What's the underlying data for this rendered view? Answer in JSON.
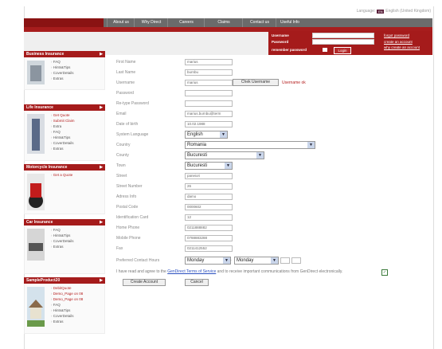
{
  "header": {
    "language_label": "Language:",
    "language_flag": "EN",
    "language_value": "English (United Kingdom)",
    "nav": [
      "About us",
      "Why Direct",
      "Careers",
      "Claims",
      "Contact us",
      "Useful Info"
    ]
  },
  "login": {
    "username_label": "Username",
    "password_label": "Password",
    "remember_label": "remember password",
    "login_button": "Login",
    "forgot_password": "forgot password",
    "create_account": "create an account",
    "why_create": "why create an account"
  },
  "sidebar": [
    {
      "title": "Business Insurance",
      "items": [
        "FAQ",
        "Hints&Tips",
        "CoverDetails",
        "Extras"
      ],
      "highlight": []
    },
    {
      "title": "Life Insurance",
      "items": [
        "Get Quote",
        "Submit Claim",
        "Extra",
        "FAQ",
        "Hints&Tips",
        "CoverDetails",
        "Extras"
      ],
      "highlight": [
        0,
        1
      ]
    },
    {
      "title": "Motorcycle Insurance",
      "items": [
        "Get a Quote"
      ],
      "highlight": [
        0
      ]
    },
    {
      "title": "Car Insurance",
      "items": [
        "FAQ",
        "Hints&Tips",
        "CoverDetails",
        "Extras"
      ],
      "highlight": []
    },
    {
      "title": "SampleProduct20",
      "items": [
        "DebitQuote",
        "Demo_Page on 08",
        "Demo_Page on 08",
        "FAQ",
        "Hints&Tips",
        "CoverDetails",
        "Extras"
      ],
      "highlight": [
        0,
        1,
        2
      ]
    }
  ],
  "form": {
    "first_name": {
      "label": "First Name",
      "value": "marius"
    },
    "last_name": {
      "label": "Last Name",
      "value": "burnbu"
    },
    "username": {
      "label": "Username",
      "value": "marius",
      "check_button": "Chek Username",
      "availability": "Username ok"
    },
    "password": {
      "label": "Password",
      "value": ""
    },
    "retype_password": {
      "label": "Re-type Password",
      "value": ""
    },
    "email": {
      "label": "Email",
      "value": "marius.burnbu@term"
    },
    "dob": {
      "label": "Date of birth",
      "value": "10.02.1988"
    },
    "system_language": {
      "label": "System Language",
      "value": "English"
    },
    "country": {
      "label": "Country",
      "value": "Romania"
    },
    "county": {
      "label": "County",
      "value": "Bucuresti"
    },
    "town": {
      "label": "Town",
      "value": "Bucuresti"
    },
    "street": {
      "label": "Street",
      "value": "paneiori"
    },
    "street_number": {
      "label": "Street Number",
      "value": "26"
    },
    "address_info": {
      "label": "Adress Info",
      "value": "damo"
    },
    "postal_code": {
      "label": "Postal Code",
      "value": "0000602"
    },
    "identification_card": {
      "label": "Identification Card",
      "value": "12"
    },
    "home_phone": {
      "label": "Home Phone",
      "value": "0211888882"
    },
    "mobile_phone": {
      "label": "Mobile Phone",
      "value": "0788883288"
    },
    "fax": {
      "label": "Fax",
      "value": "0211412552"
    },
    "contact_hours": {
      "label": "Preferred Contact Hours",
      "from_day": "Monday",
      "to_day": "Monday",
      "separator": "-"
    },
    "terms_pre": "I have read and agree to the",
    "terms_link": "GenDirect Terms of Service",
    "terms_post": "and to receive important communications from GenDirect electronically.",
    "terms_checked": "✓",
    "create_button": "Create Account",
    "cancel_button": "Cancel"
  },
  "colors": {
    "brand_red": "#a51b1b",
    "nav_gray": "#6b6b6b"
  }
}
